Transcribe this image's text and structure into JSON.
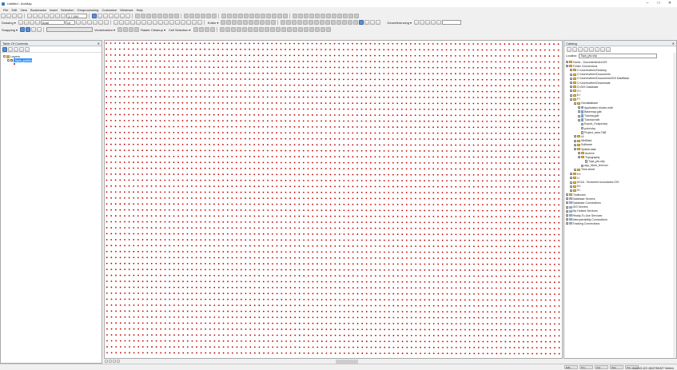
{
  "window": {
    "title": "Untitled - ArcMap",
    "controls": [
      "–",
      "□",
      "✕"
    ]
  },
  "menu": [
    "File",
    "Edit",
    "View",
    "Bookmarks",
    "Insert",
    "Selection",
    "Geoprocessing",
    "Customize",
    "Windows",
    "Help"
  ],
  "toolbar": {
    "scale_value": "1:7,000",
    "font_name": "Arial",
    "font_size": "10",
    "georeferencing_label": "Georeferencing ▾",
    "drawing_label": "Drawing ▾",
    "editor_label": "Editor ▾",
    "snapping_label": "Snapping ▾",
    "vectorization_label": "Vectorization ▾",
    "raster_cleanup_label": "Raster Cleanup ▾",
    "cell_selection_label": "Cell Selection ▾",
    "page_text_label": "Page Text"
  },
  "toc": {
    "title": "Table Of Contents",
    "pin": "✕",
    "layers_label": "Layers",
    "layer_name": "Tops_points"
  },
  "map": {
    "point_color": "#c00000"
  },
  "catalog": {
    "title": "Catalog",
    "pin": "✕",
    "location_label": "Location:",
    "location_value": "Tops_pts.shp",
    "items": [
      {
        "label": "Home - Documents\\ArcGIS",
        "icon": "folder",
        "level": 0
      },
      {
        "label": "Folder Connections",
        "icon": "folder",
        "level": 0
      },
      {
        "label": "C:\\Users\\vfeen\\Desktop",
        "icon": "folder",
        "level": 1
      },
      {
        "label": "C:\\Users\\vfeen\\Documents",
        "icon": "folder",
        "level": 1
      },
      {
        "label": "C:\\Users\\vfeen\\Documents\\GIS DataBase",
        "icon": "folder",
        "level": 1
      },
      {
        "label": "C:\\Users\\vfeen\\Downloads",
        "icon": "folder",
        "level": 1
      },
      {
        "label": "D:\\GIS Database",
        "icon": "folder",
        "level": 1
      },
      {
        "label": "G:\\",
        "icon": "folder",
        "level": 1
      },
      {
        "label": "E:\\",
        "icon": "folder",
        "level": 1
      },
      {
        "label": "F:\\",
        "icon": "folder",
        "level": 1
      },
      {
        "label": "Geodatabase",
        "icon": "folder",
        "level": 2
      },
      {
        "label": "Application blocks.mdb",
        "icon": "db",
        "level": 3
      },
      {
        "label": "Basemap.gdb",
        "icon": "db",
        "level": 3
      },
      {
        "label": "Tutorial.gdb",
        "icon": "db",
        "level": 3
      },
      {
        "label": "Tutorial.mdb",
        "icon": "db",
        "level": 3
      },
      {
        "label": "Export_Output.shp",
        "icon": "file",
        "level": 3
      },
      {
        "label": "point.shp",
        "icon": "file",
        "level": 3
      },
      {
        "label": "Project_area.TAB",
        "icon": "file",
        "level": 3
      },
      {
        "label": "UI",
        "icon": "folder",
        "level": 2
      },
      {
        "label": "MetData",
        "icon": "folder",
        "level": 2
      },
      {
        "label": "Software",
        "icon": "folder",
        "level": 2
      },
      {
        "label": "Spatial data",
        "icon": "folder",
        "level": 2
      },
      {
        "label": "Archive",
        "icon": "folder",
        "level": 3
      },
      {
        "label": "Topography",
        "icon": "folder",
        "level": 3
      },
      {
        "label": "Tops_pts.shp",
        "icon": "file",
        "level": 4
      },
      {
        "label": "app_block_text.csv",
        "icon": "file",
        "level": 3
      },
      {
        "label": "Time sheet",
        "icon": "folder",
        "level": 2
      },
      {
        "label": "H:\\",
        "icon": "folder",
        "level": 1
      },
      {
        "label": "I:\\",
        "icon": "folder",
        "level": 1
      },
      {
        "label": "M:\\16 - Tenement boundaries GIS",
        "icon": "folder",
        "level": 1
      },
      {
        "label": "N:\\",
        "icon": "folder",
        "level": 1
      },
      {
        "label": "S:\\",
        "icon": "folder",
        "level": 1
      },
      {
        "label": "Toolboxes",
        "icon": "folder",
        "level": 0
      },
      {
        "label": "Database Servers",
        "icon": "server",
        "level": 0
      },
      {
        "label": "Database Connections",
        "icon": "server",
        "level": 0
      },
      {
        "label": "GIS Servers",
        "icon": "server",
        "level": 0
      },
      {
        "label": "My Hosted Services",
        "icon": "server",
        "level": 0
      },
      {
        "label": "Ready-To-Use Services",
        "icon": "server",
        "level": 0
      },
      {
        "label": "Interoperability Connections",
        "icon": "server",
        "level": 0
      },
      {
        "label": "Tracking Connections",
        "icon": "server",
        "level": 0
      }
    ]
  },
  "taskbar": {
    "tasks": [
      "Edit...",
      "Pro...",
      "Cat...",
      "Sea...",
      "Cre..."
    ],
    "coordinates": "510243.423  4842788.827 Meters"
  }
}
